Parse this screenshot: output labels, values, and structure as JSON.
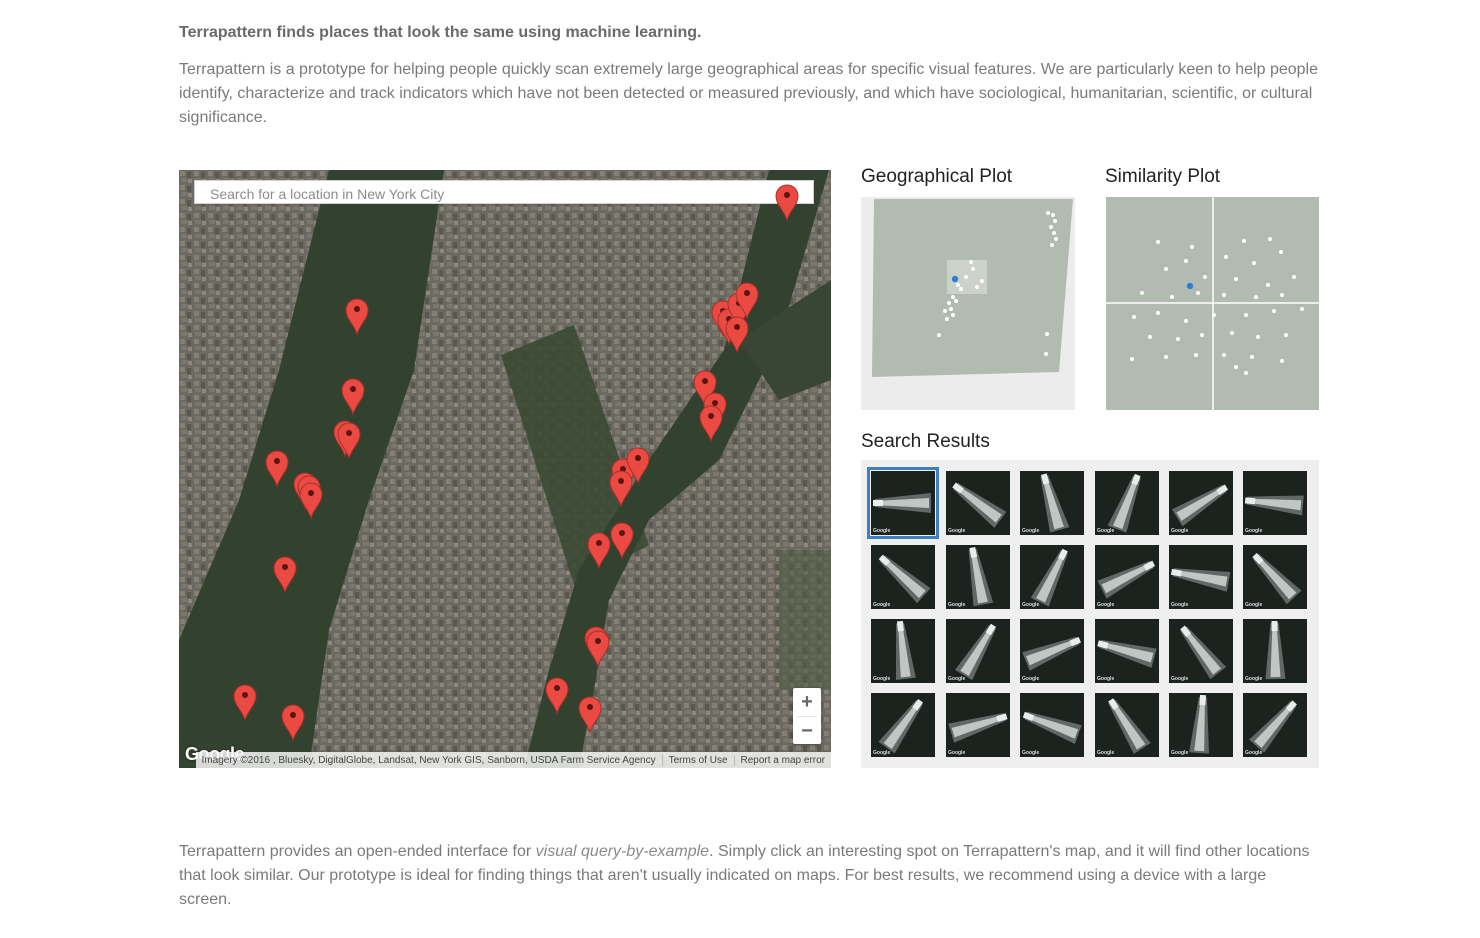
{
  "headline": "Terrapattern finds places that look the same using machine learning.",
  "intro": "Terrapattern is a prototype for helping people quickly scan extremely large geographical areas for specific visual features. We are particularly keen to help people identify, characterize and track indicators which have not been detected or measured previously, and which have sociological, humanitarian, scientific, or cultural significance.",
  "map": {
    "search_placeholder": "Search for a location in New York City",
    "zoom_in": "+",
    "zoom_out": "−",
    "logo": "Google",
    "attribution": "Imagery ©2016 , Bluesky, DigitalGlobe, Landsat, New York GIS, Sanborn, USDA Farm Service Agency",
    "terms": "Terms of Use",
    "report": "Report a map error",
    "marker_icon": "map-pin-icon"
  },
  "plots": {
    "geo_title": "Geographical Plot",
    "sim_title": "Similarity Plot",
    "plot_color": "#b2bbb0",
    "highlight_color": "#2a7fd4"
  },
  "results": {
    "title": "Search Results",
    "thumb_tag": "Google",
    "thumb_count": 24,
    "selected_index": 0
  },
  "outro": {
    "before": "Terrapattern provides an open-ended interface for ",
    "link": "visual query-by-example",
    "after": ". Simply click an interesting spot on Terrapattern's map, and it will find other locations that look similar. Our prototype is ideal for finding things that aren't usually indicated on maps. For best results, we recommend using a device with a large screen."
  }
}
